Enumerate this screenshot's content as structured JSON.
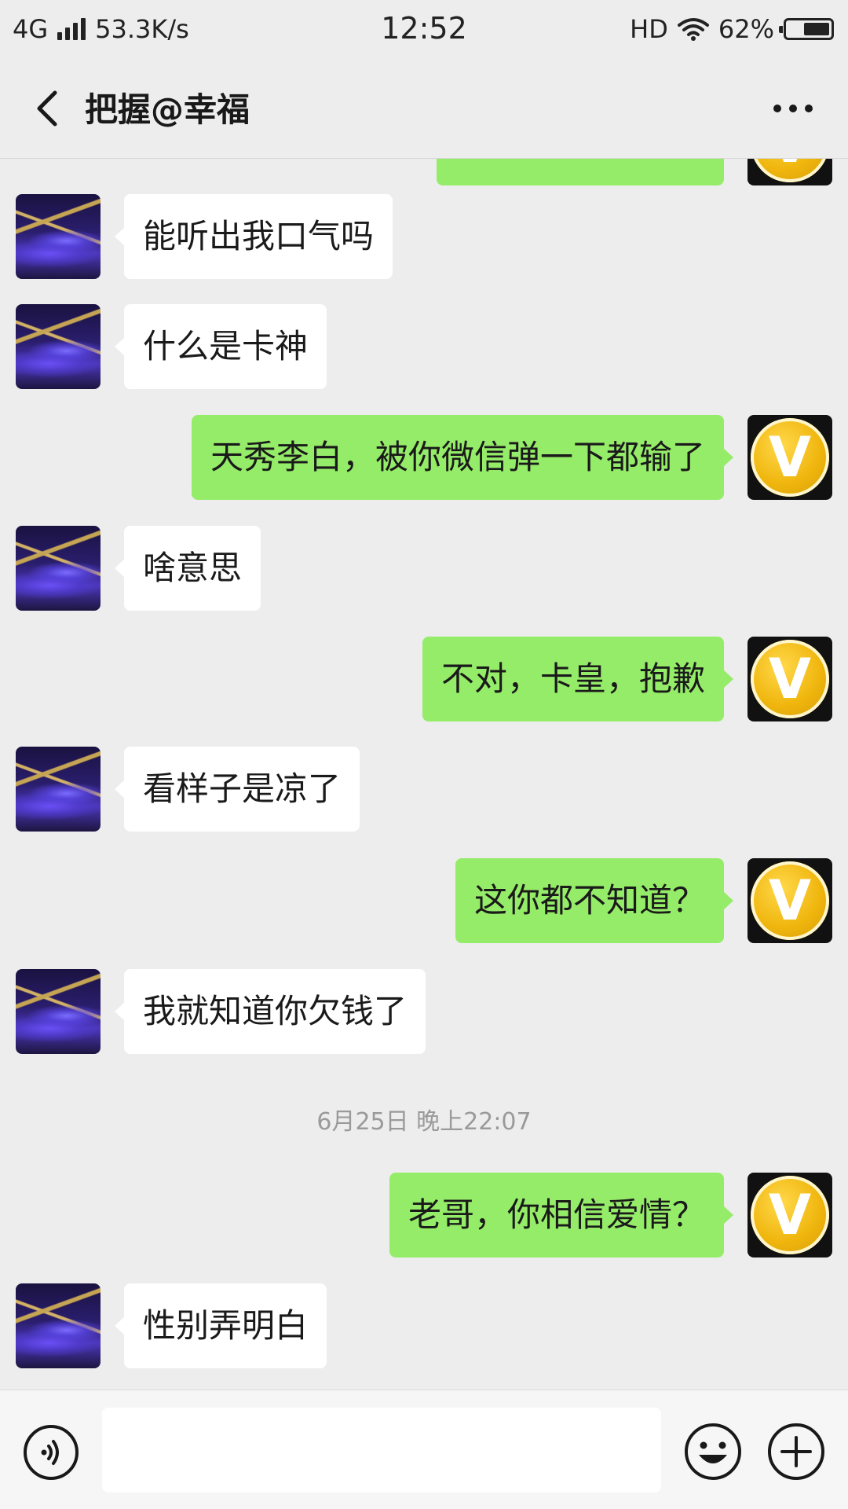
{
  "status_bar": {
    "network": "4G",
    "speed": "53.3K/s",
    "time": "12:52",
    "hd": "HD",
    "battery_text": "62%",
    "battery_level": 0.62
  },
  "header": {
    "title": "把握@幸福",
    "back_icon": "chevron-left-icon",
    "more_icon": "more-horizontal-icon"
  },
  "messages": [
    {
      "direction": "in",
      "text": "能听出我口气吗"
    },
    {
      "direction": "in",
      "text": "什么是卡神"
    },
    {
      "direction": "out",
      "text": "天秀李白，被你微信弹一下都输了"
    },
    {
      "direction": "in",
      "text": "啥意思"
    },
    {
      "direction": "out",
      "text": "不对，卡皇，抱歉"
    },
    {
      "direction": "in",
      "text": "看样子是凉了"
    },
    {
      "direction": "out",
      "text": "这你都不知道？"
    },
    {
      "direction": "in",
      "text": "我就知道你欠钱了"
    },
    {
      "direction": "out",
      "text": "老哥，你相信爱情？"
    },
    {
      "direction": "in",
      "text": "性别弄明白"
    }
  ],
  "timestamp": "6月25日 晚上22:07",
  "own_avatar_letter": "V",
  "input_bar": {
    "voice_icon": "voice-icon",
    "emoji_icon": "emoji-icon",
    "plus_icon": "plus-icon",
    "input_value": ""
  },
  "colors": {
    "background": "#ededed",
    "outgoing_bubble": "#95ec69",
    "incoming_bubble": "#ffffff",
    "timestamp_text": "#9a9a9a"
  }
}
